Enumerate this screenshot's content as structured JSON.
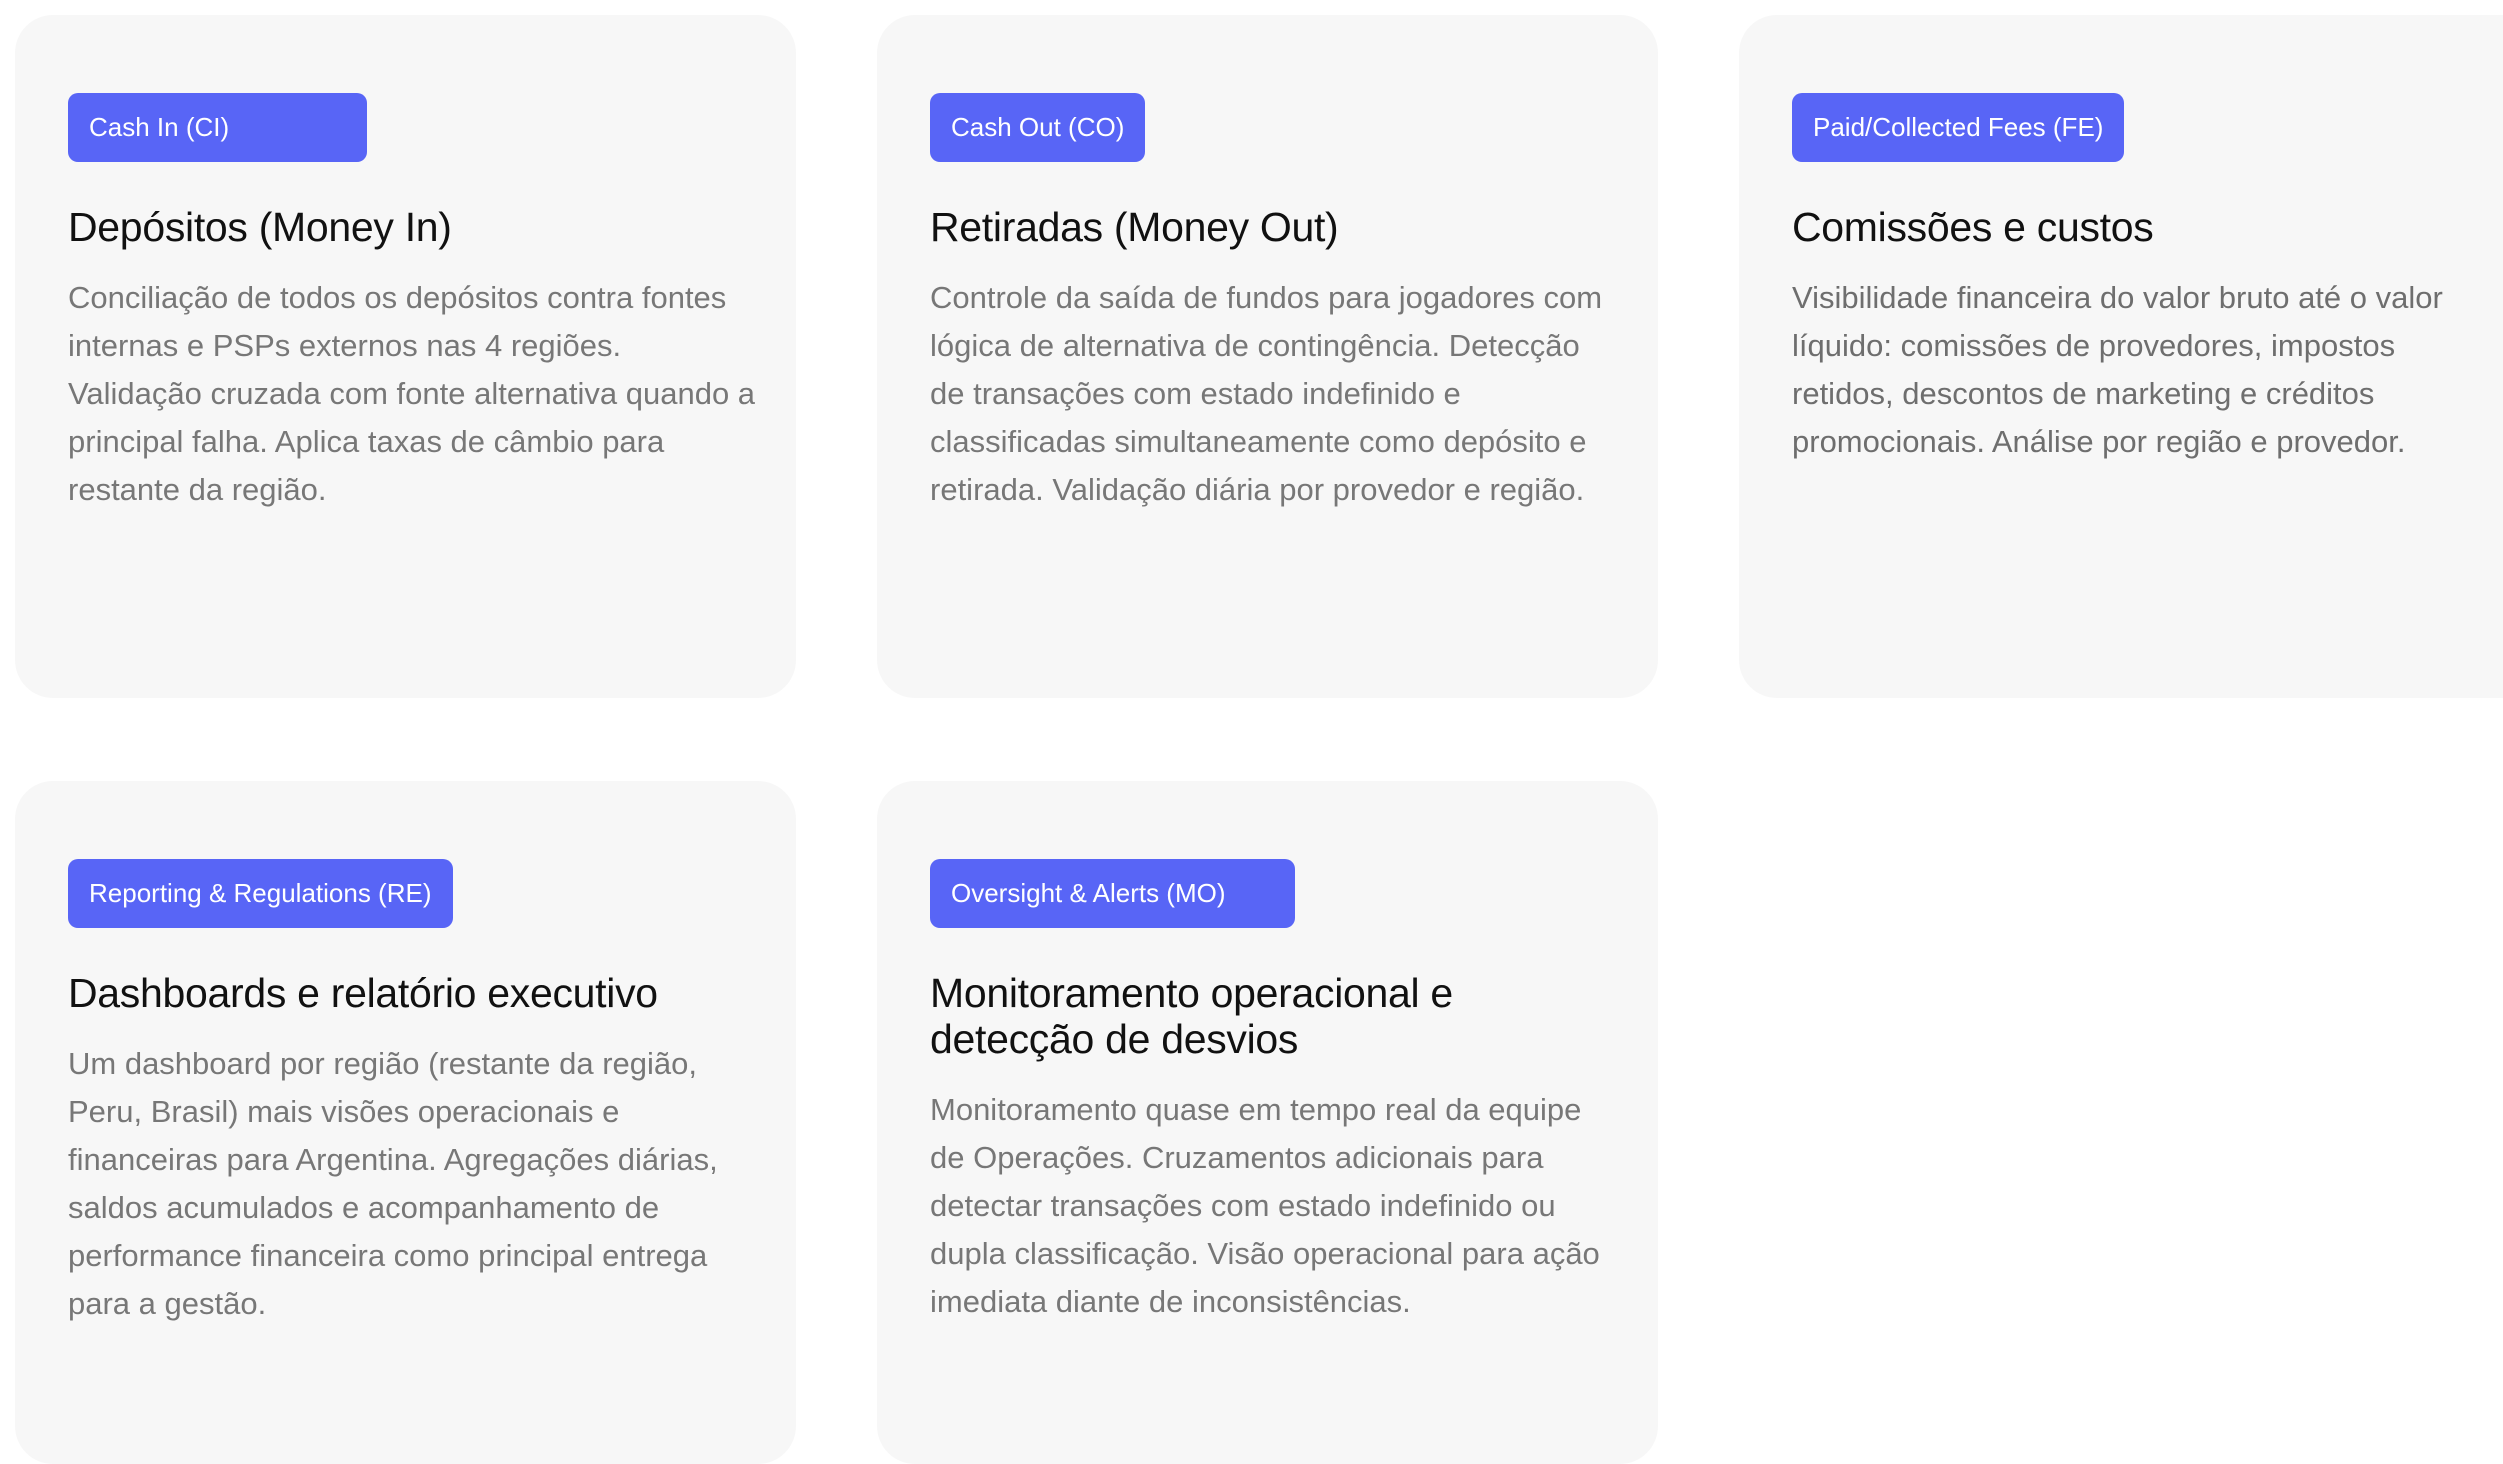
{
  "cards": [
    {
      "badge": "Cash In (CI)",
      "title": "Depósitos (Money In)",
      "description": "Conciliação de todos os depósitos contra fontes internas e PSPs externos nas 4 regiões. Validação cruzada com fonte alternativa quando a principal falha. Aplica taxas de câmbio para restante da região."
    },
    {
      "badge": "Cash Out (CO)",
      "title": "Retiradas (Money Out)",
      "description": "Controle da saída de fundos para jogadores com lógica de alternativa de contingência. Detecção de transações com estado indefinido e classificadas simultaneamente como depósito e retirada. Validação diária por provedor e região."
    },
    {
      "badge": "Paid/Collected Fees (FE)",
      "title": "Comissões e custos",
      "description": "Visibilidade financeira do valor bruto até o valor líquido: comissões de provedores, impostos retidos, descontos de marketing e créditos promocionais. Análise por região e provedor."
    },
    {
      "badge": "Reporting & Regulations (RE)",
      "title": "Dashboards e relatório executivo",
      "description": "Um dashboard por região (restante da região, Peru, Brasil) mais visões operacionais e financeiras para Argentina. Agregações diárias, saldos acumulados e acompanhamento de performance financeira como principal entrega para a gestão."
    },
    {
      "badge": "Oversight & Alerts (MO)",
      "title": "Monitoramento operacional e detecção de desvios",
      "description": "Monitoramento quase em tempo real da equipe de Operações. Cruzamentos adicionais para detectar transações com estado indefinido ou dupla classificação. Visão operacional para ação imediata diante de inconsistências."
    }
  ],
  "colors": {
    "badge_bg": "#5865f6",
    "card_bg": "#f7f7f7",
    "title_text": "#111111",
    "body_text": "#777777"
  }
}
